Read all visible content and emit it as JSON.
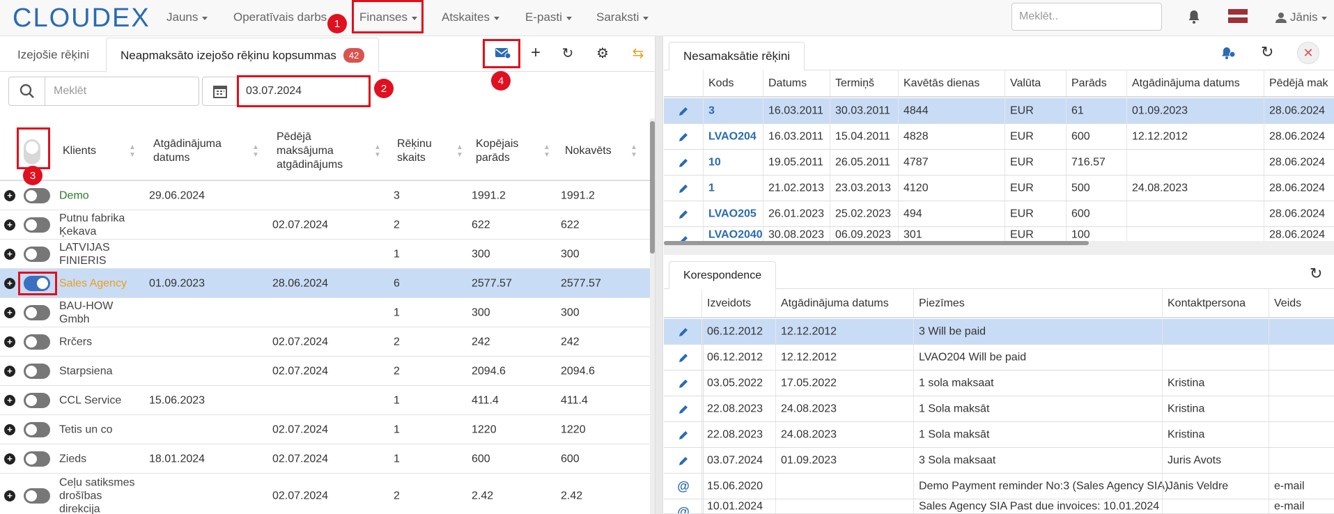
{
  "nav": {
    "logo": "CLOUDEX",
    "items": [
      "Jauns",
      "Operatīvais darbs",
      "Finanses",
      "Atskaites",
      "E-pasti",
      "Saraksti"
    ],
    "search_placeholder": "Meklēt..",
    "user": "Jānis"
  },
  "markers": [
    "1",
    "2",
    "3",
    "4"
  ],
  "left": {
    "tabs": [
      "Izejošie rēķini",
      "Neapmaksāto izejošo rēķinu kopsummas"
    ],
    "tab_count": "42",
    "search_placeholder": "Meklēt",
    "date": "03.07.2024",
    "headers": [
      "Klients",
      "Atgādinājuma datums",
      "Pēdējā maksājuma atgādinājums",
      "Rēķinu skaits",
      "Kopējais parāds",
      "Nokavēts"
    ],
    "rows": [
      {
        "client": "Demo",
        "reminder": "29.06.2024",
        "last": "",
        "count": "3",
        "total": "1991.2",
        "overdue": "1991.2",
        "on": false
      },
      {
        "client": "Putnu fabrika Ķekava",
        "reminder": "",
        "last": "02.07.2024",
        "count": "2",
        "total": "622",
        "overdue": "622",
        "on": false
      },
      {
        "client": "LATVIJAS FINIERIS",
        "reminder": "",
        "last": "",
        "count": "1",
        "total": "300",
        "overdue": "300",
        "on": false
      },
      {
        "client": "Sales Agency",
        "reminder": "01.09.2023",
        "last": "28.06.2024",
        "count": "6",
        "total": "2577.57",
        "overdue": "2577.57",
        "on": true
      },
      {
        "client": "BAU-HOW Gmbh",
        "reminder": "",
        "last": "",
        "count": "1",
        "total": "300",
        "overdue": "300",
        "on": false
      },
      {
        "client": "Rrčers",
        "reminder": "",
        "last": "02.07.2024",
        "count": "2",
        "total": "242",
        "overdue": "242",
        "on": false
      },
      {
        "client": "Starpsiena",
        "reminder": "",
        "last": "02.07.2024",
        "count": "2",
        "total": "2094.6",
        "overdue": "2094.6",
        "on": false
      },
      {
        "client": "CCL Service",
        "reminder": "15.06.2023",
        "last": "",
        "count": "1",
        "total": "411.4",
        "overdue": "411.4",
        "on": false
      },
      {
        "client": "Tetis un co",
        "reminder": "",
        "last": "02.07.2024",
        "count": "1",
        "total": "1220",
        "overdue": "1220",
        "on": false
      },
      {
        "client": "Zieds",
        "reminder": "18.01.2024",
        "last": "02.07.2024",
        "count": "1",
        "total": "600",
        "overdue": "600",
        "on": false
      },
      {
        "client": "Ceļu satiksmes drošības direkcija",
        "reminder": "",
        "last": "02.07.2024",
        "count": "2",
        "total": "2.42",
        "overdue": "2.42",
        "on": false
      }
    ]
  },
  "invoices": {
    "tab": "Nesamaksātie rēķini",
    "headers": [
      "Kods",
      "Datums",
      "Termiņš",
      "Kavētās dienas",
      "Valūta",
      "Parāds",
      "Atgādinājuma datums",
      "Pēdējā mak"
    ],
    "rows": [
      [
        "3",
        "16.03.2011",
        "30.03.2011",
        "4844",
        "EUR",
        "61",
        "01.09.2023",
        "28.06.2024"
      ],
      [
        "LVAO204",
        "16.03.2011",
        "15.04.2011",
        "4828",
        "EUR",
        "600",
        "12.12.2012",
        "28.06.2024"
      ],
      [
        "10",
        "19.05.2011",
        "26.05.2011",
        "4787",
        "EUR",
        "716.57",
        "",
        "28.06.2024"
      ],
      [
        "1",
        "21.02.2013",
        "23.03.2013",
        "4120",
        "EUR",
        "500",
        "24.08.2023",
        "28.06.2024"
      ],
      [
        "LVAO205",
        "26.01.2023",
        "25.02.2023",
        "494",
        "EUR",
        "600",
        "",
        "28.06.2024"
      ],
      [
        "LVAO2040",
        "30.08.2023",
        "06.09.2023",
        "301",
        "EUR",
        "100",
        "",
        "28.06.2024"
      ]
    ]
  },
  "correspondence": {
    "tab": "Korespondence",
    "headers": [
      "Izveidots",
      "Atgādinājuma datums",
      "Piezīmes",
      "Kontaktpersona",
      "Veids"
    ],
    "rows": [
      {
        "icon": "pencil",
        "c": [
          "06.12.2012",
          "12.12.2012",
          "3 Will be paid",
          "",
          ""
        ]
      },
      {
        "icon": "pencil",
        "c": [
          "06.12.2012",
          "12.12.2012",
          "LVAO204 Will be paid",
          "",
          ""
        ]
      },
      {
        "icon": "pencil",
        "c": [
          "03.05.2022",
          "17.05.2022",
          "1 sola maksaat",
          "Kristina",
          ""
        ]
      },
      {
        "icon": "pencil",
        "c": [
          "22.08.2023",
          "24.08.2023",
          "1 Sola maksāt",
          "Kristina",
          ""
        ]
      },
      {
        "icon": "pencil",
        "c": [
          "22.08.2023",
          "24.08.2023",
          "1 Sola maksāt",
          "Kristina",
          ""
        ]
      },
      {
        "icon": "pencil",
        "c": [
          "03.07.2024",
          "01.09.2023",
          "3 Sola maksaat",
          "Juris Avots",
          ""
        ]
      },
      {
        "icon": "at",
        "c": [
          "15.06.2020",
          "",
          "Demo Payment reminder No:3 (Sales Agency SIA)",
          "Jānis Veldre",
          "e-mail"
        ]
      },
      {
        "icon": "at",
        "c": [
          "10.01.2024",
          "",
          "Sales Agency SIA Past due invoices: 10.01.2024",
          "",
          "e-mail"
        ]
      }
    ]
  }
}
